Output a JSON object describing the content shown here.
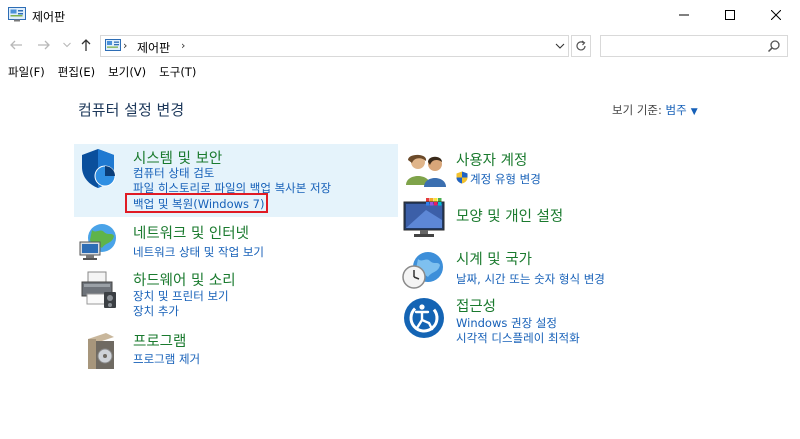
{
  "window": {
    "title": "제어판",
    "minimize_icon": "minimize-icon",
    "maximize_icon": "maximize-icon",
    "close_icon": "close-icon"
  },
  "address": {
    "crumb": "제어판",
    "search_placeholder": ""
  },
  "menu": [
    "파일(F)",
    "편집(E)",
    "보기(V)",
    "도구(T)"
  ],
  "content": {
    "title": "컴퓨터 설정 변경",
    "view_by_label": "보기 기준:",
    "view_by_value": "범주"
  },
  "categories": {
    "system": {
      "title": "시스템 및 보안",
      "links": [
        "컴퓨터 상태 검토",
        "파일 히스토리로 파일의 백업 복사본 저장",
        "백업 및 복원(Windows 7)"
      ]
    },
    "network": {
      "title": "네트워크 및 인터넷",
      "links": [
        "네트워크 상태 및 작업 보기"
      ]
    },
    "hardware": {
      "title": "하드웨어 및 소리",
      "links": [
        "장치 및 프린터 보기",
        "장치 추가"
      ]
    },
    "programs": {
      "title": "프로그램",
      "links": [
        "프로그램 제거"
      ]
    },
    "users": {
      "title": "사용자 계정",
      "links": [
        "계정 유형 변경"
      ]
    },
    "appearance": {
      "title": "모양 및 개인 설정",
      "links": []
    },
    "clock": {
      "title": "시계 및 국가",
      "links": [
        "날짜, 시간 또는 숫자 형식 변경"
      ]
    },
    "access": {
      "title": "접근성",
      "links": [
        "Windows 권장 설정",
        "시각적 디스플레이 최적화"
      ]
    }
  },
  "colors": {
    "category_title": "#1a7a2e",
    "link": "#1660b8",
    "highlight_border": "#e01b24",
    "hover_bg": "#e5f3fb"
  }
}
